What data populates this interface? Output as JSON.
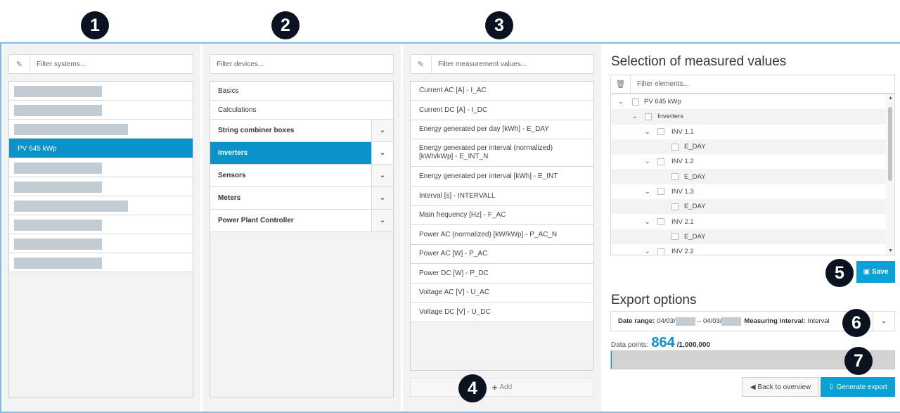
{
  "markers": [
    "1",
    "2",
    "3",
    "4",
    "5",
    "6",
    "7"
  ],
  "systems": {
    "filter_placeholder": "Filter systems...",
    "selected_label": "PV 645 kWp"
  },
  "devices": {
    "filter_placeholder": "Filter devices...",
    "items": [
      "Basics",
      "Calculations"
    ],
    "groups": [
      "String combiner boxes",
      "Inverters",
      "Sensors",
      "Meters",
      "Power Plant Controller"
    ]
  },
  "measurements": {
    "filter_placeholder": "Filter measurement values...",
    "items": [
      "Current AC [A] - I_AC",
      "Current DC [A] - I_DC",
      "Energy generated per day [kWh] - E_DAY",
      "Energy generated per interval (normalized) [kWh/kWp] - E_INT_N",
      "Energy generated per interval [kWh] - E_INT",
      "Interval [s] - INTERVALL",
      "Main frequency [Hz] - F_AC",
      "Power AC (normalized) [kW/kWp] - P_AC_N",
      "Power AC [W] - P_AC",
      "Power DC [W] - P_DC",
      "Voltage AC [V] - U_AC",
      "Voltage DC [V] - U_DC"
    ],
    "add_label": "Add"
  },
  "selection": {
    "title": "Selection of measured values",
    "filter_placeholder": "Filter elements...",
    "tree": [
      {
        "label": "PV 645 kWp",
        "level": 0,
        "expandable": true
      },
      {
        "label": "Inverters",
        "level": 1,
        "expandable": true
      },
      {
        "label": "INV 1.1",
        "level": 2,
        "expandable": true
      },
      {
        "label": "E_DAY",
        "level": 3,
        "expandable": false
      },
      {
        "label": "INV 1.2",
        "level": 2,
        "expandable": true
      },
      {
        "label": "E_DAY",
        "level": 3,
        "expandable": false
      },
      {
        "label": "INV 1.3",
        "level": 2,
        "expandable": true
      },
      {
        "label": "E_DAY",
        "level": 3,
        "expandable": false
      },
      {
        "label": "INV 2.1",
        "level": 2,
        "expandable": true
      },
      {
        "label": "E_DAY",
        "level": 3,
        "expandable": false
      },
      {
        "label": "INV 2.2",
        "level": 2,
        "expandable": true
      }
    ],
    "save_label": "Save"
  },
  "export": {
    "title": "Export options",
    "date_range_label": "Date range:",
    "date_from": "04/03/",
    "date_separator": "–",
    "date_to": "04/03/",
    "interval_label": "Measuring interval:",
    "interval_value": "Interval",
    "datapoints_label": "Data points:",
    "datapoints_value": "864",
    "datapoints_total": "/1,000,000",
    "datapoints_fraction": 0.000864,
    "back_label": "Back to overview",
    "generate_label": "Generate export"
  },
  "colors": {
    "accent": "#0a93c9",
    "marker": "#0b1320"
  }
}
